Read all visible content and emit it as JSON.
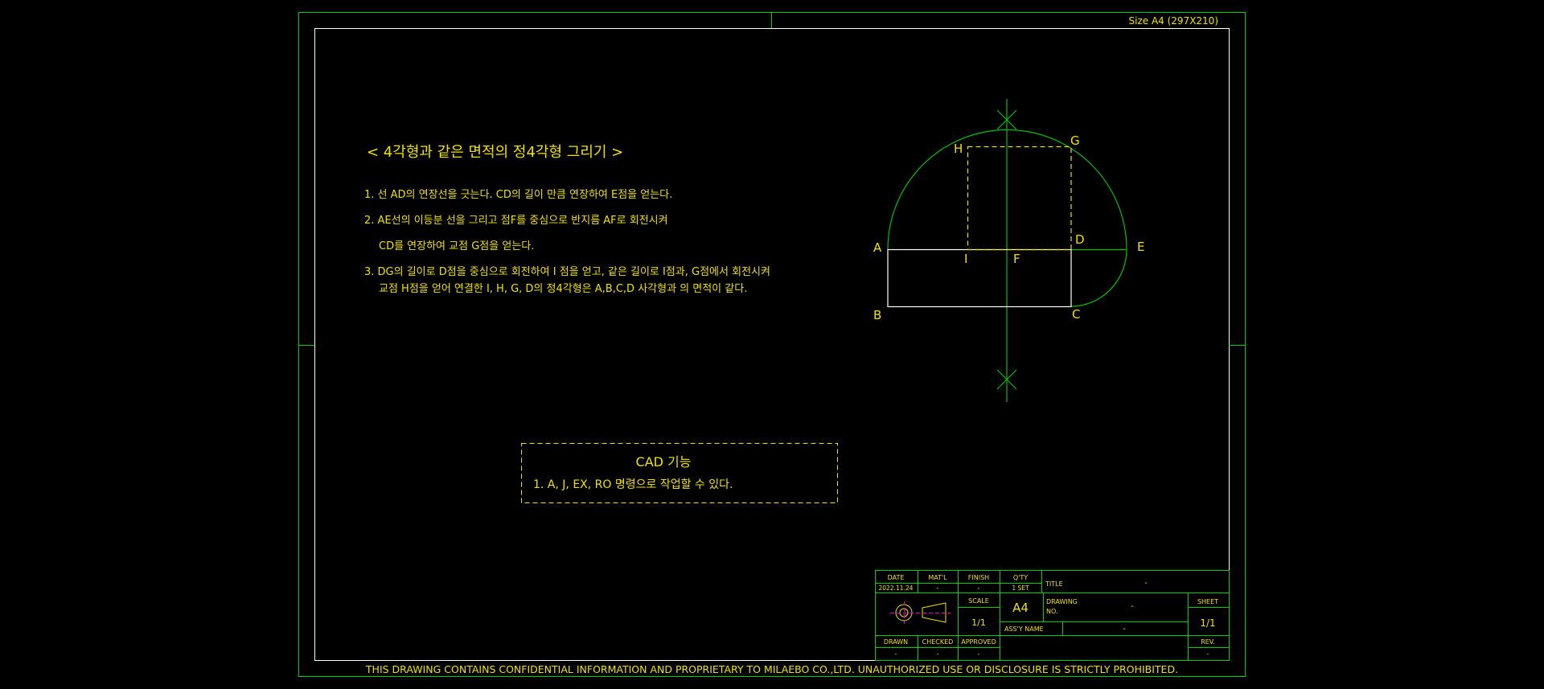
{
  "sheet": {
    "size_label": "Size A4 (297X210)",
    "confidential": "THIS DRAWING CONTAINS CONFIDENTIAL INFORMATION AND PROPRIETARY TO MILAEBO CO.,LTD. UNAUTHORIZED USE OR DISCLOSURE IS STRICTLY PROHIBITED."
  },
  "instructions": {
    "title": "< 4각형과 같은 면적의 정4각형 그리기 >",
    "step1": "1. 선 AD의 연장선을 긋는다. CD의 길이 만큼 연장하여 E점을 얻는다.",
    "step2a": "2. AE선의 이등분 선을 그리고 점F를 중심으로 반지름 AF로 회전시켜",
    "step2b": "CD를 연장하여 교점 G점을 얻는다.",
    "step3a": "3. DG의 길이로 D점을 중심으로 회전하여 I 점을 얻고, 같은 길이로 I점과, G점에서 회전시켜",
    "step3b": "교점 H점을 얻어 연결한 I, H, G, D의 정4각형은 A,B,C,D 사각형과 의 면적이 같다."
  },
  "cad_box": {
    "title": "CAD 기능",
    "line1": "1. A, J, EX, RO 명령으로 작업할 수 있다."
  },
  "points": {
    "A": "A",
    "B": "B",
    "C": "C",
    "D": "D",
    "E": "E",
    "F": "F",
    "G": "G",
    "H": "H",
    "I": "I"
  },
  "title_block": {
    "h_date": "DATE",
    "h_matl": "MAT'L",
    "h_finish": "FINISH",
    "h_qty": "Q'TY",
    "v_date": "2022.11.24",
    "v_matl": "-",
    "v_finish": "-",
    "v_qty": "1 SET",
    "title_label": "TITLE",
    "title_value": "-",
    "scale_label": "SCALE",
    "scale_value": "1/1",
    "size_value": "A4",
    "drawing_no_label1": "DRAWING",
    "drawing_no_label2": "NO.",
    "drawing_no_value": "-",
    "assy_label": "ASS'Y NAME",
    "assy_value": "-",
    "sheet_label": "SHEET",
    "sheet_value": "1/1",
    "rev_label": "REV.",
    "rev_value": "-",
    "drawn_label": "DRAWN",
    "checked_label": "CHECKED",
    "approved_label": "APPROVED",
    "drawn_value": "-",
    "checked_value": "-",
    "approved_value": "-"
  },
  "colors": {
    "frame": "#00d000",
    "text": "#f0e000",
    "construction": "#00c000",
    "rectangle": "#ffffff",
    "projection_center": "#e000e0"
  }
}
